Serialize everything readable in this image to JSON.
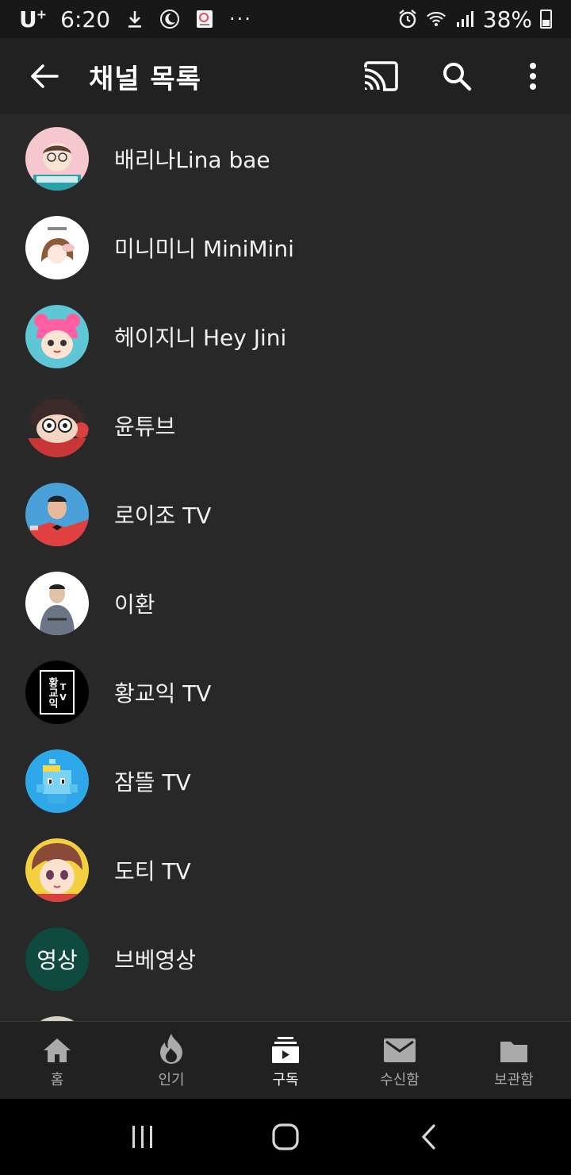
{
  "status_bar": {
    "carrier": "U",
    "carrier_sup": "+",
    "time": "6:20",
    "battery": "38%",
    "more": "···",
    "battery_level": 0.38
  },
  "app_bar": {
    "title": "채널 목록"
  },
  "channels": [
    {
      "name": "배리나Lina bae",
      "avatar": "cartoon-glasses"
    },
    {
      "name": "미니미니 MiniMini",
      "avatar": "cartoon-girl-sketch"
    },
    {
      "name": "헤이지니 Hey Jini",
      "avatar": "cartoon-pink-hair"
    },
    {
      "name": "윤튜브",
      "avatar": "cartoon-monkey"
    },
    {
      "name": "로이조 TV",
      "avatar": "photo-man-bowtie"
    },
    {
      "name": "이환",
      "avatar": "photo-man-jacket"
    },
    {
      "name": "황교익 TV",
      "avatar": "text-logo",
      "avatar_text_left": "황교익",
      "avatar_text_right": "TV"
    },
    {
      "name": "잠뜰 TV",
      "avatar": "pixel-character"
    },
    {
      "name": "도티 TV",
      "avatar": "anime-boy"
    },
    {
      "name": "브베영상",
      "avatar": "text-logo",
      "avatar_text": "영상"
    }
  ],
  "bottom_nav": [
    {
      "label": "홈",
      "icon": "home-icon",
      "active": false
    },
    {
      "label": "인기",
      "icon": "flame-icon",
      "active": false
    },
    {
      "label": "구독",
      "icon": "subscriptions-icon",
      "active": true
    },
    {
      "label": "수신함",
      "icon": "mail-icon",
      "active": false
    },
    {
      "label": "보관함",
      "icon": "folder-icon",
      "active": false
    }
  ],
  "colors": {
    "background": "#282828",
    "app_bar": "#212121",
    "status_bar": "#181818",
    "text": "#f1f1f1",
    "inactive": "#aaaaaa"
  }
}
